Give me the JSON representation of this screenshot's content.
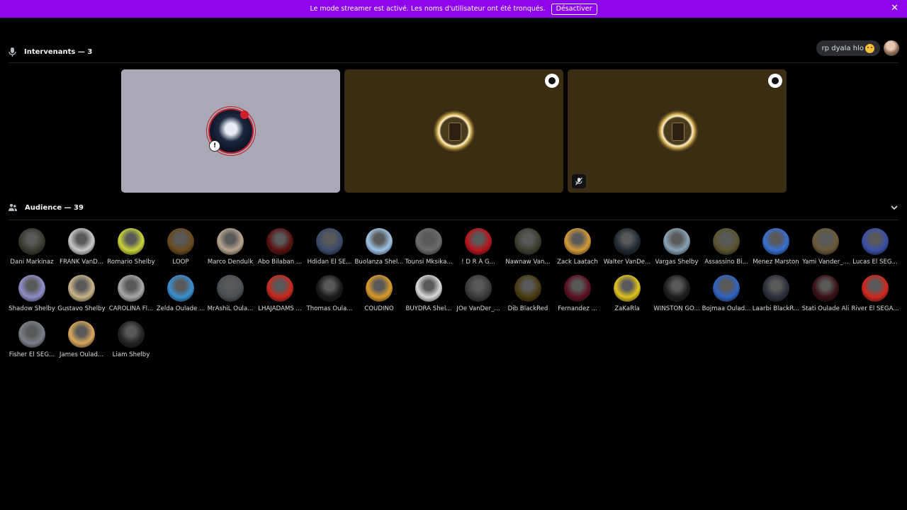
{
  "banner": {
    "message": "Le mode streamer est activé. Les noms d'utilisateur ont été tronqués.",
    "button_label": "Désactiver",
    "color": "#8c05ec"
  },
  "speakers": {
    "title": "Intervenants — 3",
    "icon": "microphone-icon",
    "tiles": [
      {
        "background": "#a8a9b5"
      },
      {
        "background": "#3a2d14",
        "moderator": true
      },
      {
        "background": "#3a2d14",
        "moderator": true,
        "muted": true
      }
    ]
  },
  "header_right": {
    "status_text": "rp dyala hlo"
  },
  "audience": {
    "title": "Audience — 39",
    "icon": "audience-icon",
    "members": [
      {
        "name": "Dani Markinaz",
        "color": "#3a3a2e"
      },
      {
        "name": "FRANK VanD...",
        "color": "#c9c9c9"
      },
      {
        "name": "Romario Shelby",
        "color": "#c9d43a"
      },
      {
        "name": "LOOP",
        "color": "#6b4b1f"
      },
      {
        "name": "Marco Dendulk",
        "color": "#b8a591"
      },
      {
        "name": "Abo Bilaban ...",
        "color": "#5a1010"
      },
      {
        "name": "Hdidan El SE...",
        "color": "#3b4b6b"
      },
      {
        "name": "Buolanza Shel...",
        "color": "#9fc3e6"
      },
      {
        "name": "Tounsi Mksika...",
        "color": "#6b6b6b"
      },
      {
        "name": "! D R A G...",
        "color": "#b8141e"
      },
      {
        "name": "Nawnaw Van...",
        "color": "#3d3d2f"
      },
      {
        "name": "Zack Laatach",
        "color": "#d49a3a"
      },
      {
        "name": "Walter VanDe...",
        "color": "#1f2a33"
      },
      {
        "name": "Vargas Shelby",
        "color": "#8aa3b5"
      },
      {
        "name": "Assassino Bi...",
        "color": "#5a5430"
      },
      {
        "name": "Menez Marston",
        "color": "#3a6fd1"
      },
      {
        "name": "Yami Vander_...",
        "color": "#6b5a3a"
      },
      {
        "name": "Lucas El SEG...",
        "color": "#3a4fa8"
      },
      {
        "name": "Shadow Shelby",
        "color": "#8f8fc9"
      },
      {
        "name": "Gustavo Shelby",
        "color": "#c9b58a"
      },
      {
        "name": "CAROLINA Fl...",
        "color": "#a8a8a8"
      },
      {
        "name": "Zelda Oulade ...",
        "color": "#3a8fd1"
      },
      {
        "name": "MrAshiL Oula...",
        "color": "#4b4f55"
      },
      {
        "name": "LHAJADAMS ...",
        "color": "#c9281e"
      },
      {
        "name": "Thomas Oula...",
        "color": "#1a1a1a"
      },
      {
        "name": "COUDINO",
        "color": "#d89a2a"
      },
      {
        "name": "BUYDRA Shel...",
        "color": "#d9d9d9"
      },
      {
        "name": "JOe VanDer_...",
        "color": "#3a3a3a"
      },
      {
        "name": "Dib BlackRed",
        "color": "#4a3a10"
      },
      {
        "name": "Fernandez ...",
        "color": "#5a1020"
      },
      {
        "name": "ZaKaRla",
        "color": "#e0c21f"
      },
      {
        "name": "WINSTON GO...",
        "color": "#1c1c1c"
      },
      {
        "name": "Bojmaa Oulad...",
        "color": "#2f64c2"
      },
      {
        "name": "Laarbi BlackR...",
        "color": "#2a2f3a"
      },
      {
        "name": "Stati Oulade Ali",
        "color": "#3a0f14"
      },
      {
        "name": "River El SEGA...",
        "color": "#d1281e"
      },
      {
        "name": "Fisher El SEG...",
        "color": "#7a7f88"
      },
      {
        "name": "James Oulad...",
        "color": "#d9a85a"
      },
      {
        "name": "Liam Shelby",
        "color": "#222222"
      }
    ]
  }
}
